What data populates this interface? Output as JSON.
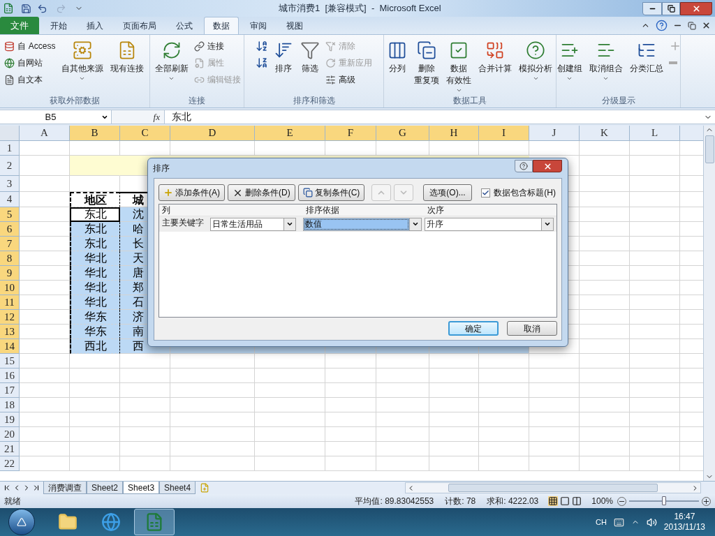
{
  "window": {
    "title": "城市消费1  [兼容模式]  -  Microsoft Excel"
  },
  "ribbon_tabs": [
    {
      "label": "文件",
      "kind": "file",
      "selected": false
    },
    {
      "label": "开始",
      "kind": "tab",
      "selected": false
    },
    {
      "label": "插入",
      "kind": "tab",
      "selected": false
    },
    {
      "label": "页面布局",
      "kind": "tab",
      "selected": false
    },
    {
      "label": "公式",
      "kind": "tab",
      "selected": false
    },
    {
      "label": "数据",
      "kind": "tab",
      "selected": true
    },
    {
      "label": "审阅",
      "kind": "tab",
      "selected": false
    },
    {
      "label": "视图",
      "kind": "tab",
      "selected": false
    }
  ],
  "ribbon_groups": [
    {
      "label": "获取外部数据",
      "items": [
        {
          "kind": "small",
          "label": "自 Access",
          "disabled": false,
          "dropdown": false
        },
        {
          "kind": "small",
          "label": "自网站",
          "disabled": false,
          "dropdown": false
        },
        {
          "kind": "small",
          "label": "自文本",
          "disabled": false,
          "dropdown": false
        },
        {
          "kind": "large",
          "label": "自其他来源",
          "disabled": false,
          "dropdown": true
        },
        {
          "kind": "large",
          "label": "现有连接",
          "disabled": false,
          "dropdown": false
        }
      ]
    },
    {
      "label": "连接",
      "items": [
        {
          "kind": "large",
          "label": "全部刷新",
          "disabled": false,
          "dropdown": true
        },
        {
          "kind": "small",
          "label": "连接",
          "disabled": false,
          "dropdown": false
        },
        {
          "kind": "small",
          "label": "属性",
          "disabled": true,
          "dropdown": false
        },
        {
          "kind": "small",
          "label": "编辑链接",
          "disabled": true,
          "dropdown": false
        }
      ]
    },
    {
      "label": "排序和筛选",
      "items": [
        {
          "kind": "icon",
          "disabled": false,
          "dropdown": false
        },
        {
          "kind": "icon",
          "disabled": false,
          "dropdown": false
        },
        {
          "kind": "large",
          "label": "排序",
          "disabled": false,
          "dropdown": false
        },
        {
          "kind": "large",
          "label": "筛选",
          "disabled": false,
          "dropdown": false
        },
        {
          "kind": "small",
          "label": "清除",
          "disabled": true,
          "dropdown": false
        },
        {
          "kind": "small",
          "label": "重新应用",
          "disabled": true,
          "dropdown": false
        },
        {
          "kind": "small",
          "label": "高级",
          "disabled": false,
          "dropdown": false
        }
      ]
    },
    {
      "label": "数据工具",
      "items": [
        {
          "kind": "large",
          "label": "分列",
          "disabled": false,
          "dropdown": false
        },
        {
          "kind": "large",
          "lines": [
            "删除",
            "重复项"
          ],
          "disabled": false,
          "dropdown": false
        },
        {
          "kind": "large",
          "lines": [
            "数据",
            "有效性"
          ],
          "disabled": false,
          "dropdown": true
        },
        {
          "kind": "large",
          "label": "合并计算",
          "disabled": false,
          "dropdown": false
        },
        {
          "kind": "large",
          "label": "模拟分析",
          "disabled": false,
          "dropdown": true
        }
      ]
    },
    {
      "label": "分级显示",
      "items": [
        {
          "kind": "large",
          "label": "创建组",
          "disabled": false,
          "dropdown": true
        },
        {
          "kind": "large",
          "label": "取消组合",
          "disabled": false,
          "dropdown": true
        },
        {
          "kind": "large",
          "label": "分类汇总",
          "disabled": false,
          "dropdown": false
        },
        {
          "kind": "icon",
          "disabled": true,
          "dropdown": false
        },
        {
          "kind": "icon",
          "disabled": true,
          "dropdown": false
        }
      ]
    }
  ],
  "formula_bar": {
    "name_box": "B5",
    "function_label": "fx",
    "value": "东北"
  },
  "columns": [
    {
      "label": "A",
      "selected": false
    },
    {
      "label": "B",
      "selected": true
    },
    {
      "label": "C",
      "selected": true
    },
    {
      "label": "D",
      "selected": true
    },
    {
      "label": "E",
      "selected": true
    },
    {
      "label": "F",
      "selected": true
    },
    {
      "label": "G",
      "selected": true
    },
    {
      "label": "H",
      "selected": true
    },
    {
      "label": "I",
      "selected": true
    },
    {
      "label": "J",
      "selected": false
    },
    {
      "label": "K",
      "selected": false
    },
    {
      "label": "L",
      "selected": false
    }
  ],
  "rows": [
    {
      "label": "1",
      "selected": false,
      "cells": []
    },
    {
      "label": "2",
      "selected": false,
      "cells": []
    },
    {
      "label": "3",
      "selected": false,
      "cells": []
    },
    {
      "label": "4",
      "selected": false,
      "cells": [
        {
          "text": "地区",
          "active": false
        },
        {
          "text": "城",
          "active": false
        }
      ]
    },
    {
      "label": "5",
      "selected": true,
      "cells": [
        {
          "text": "东北",
          "active": true
        },
        {
          "text": "沈",
          "active": false
        }
      ]
    },
    {
      "label": "6",
      "selected": true,
      "cells": [
        {
          "text": "东北",
          "active": false
        },
        {
          "text": "哈",
          "active": false
        }
      ]
    },
    {
      "label": "7",
      "selected": true,
      "cells": [
        {
          "text": "东北",
          "active": false
        },
        {
          "text": "长",
          "active": false
        }
      ]
    },
    {
      "label": "8",
      "selected": true,
      "cells": [
        {
          "text": "华北",
          "active": false
        },
        {
          "text": "天",
          "active": false
        }
      ]
    },
    {
      "label": "9",
      "selected": true,
      "cells": [
        {
          "text": "华北",
          "active": false
        },
        {
          "text": "唐",
          "active": false
        }
      ]
    },
    {
      "label": "10",
      "selected": true,
      "cells": [
        {
          "text": "华北",
          "active": false
        },
        {
          "text": "郑",
          "active": false
        }
      ]
    },
    {
      "label": "11",
      "selected": true,
      "cells": [
        {
          "text": "华北",
          "active": false
        },
        {
          "text": "石",
          "active": false
        }
      ]
    },
    {
      "label": "12",
      "selected": true,
      "cells": [
        {
          "text": "华东",
          "active": false
        },
        {
          "text": "济",
          "active": false
        }
      ]
    },
    {
      "label": "13",
      "selected": true,
      "cells": [
        {
          "text": "华东",
          "active": false
        },
        {
          "text": "南",
          "active": false
        }
      ]
    },
    {
      "label": "14",
      "selected": true,
      "cells": [
        {
          "text": "西北",
          "active": false
        },
        {
          "text": "西",
          "active": false
        }
      ]
    },
    {
      "label": "15",
      "selected": false,
      "cells": []
    },
    {
      "label": "16",
      "selected": false,
      "cells": []
    },
    {
      "label": "17",
      "selected": false,
      "cells": []
    },
    {
      "label": "18",
      "selected": false,
      "cells": []
    },
    {
      "label": "19",
      "selected": false,
      "cells": []
    },
    {
      "label": "20",
      "selected": false,
      "cells": []
    },
    {
      "label": "21",
      "selected": false,
      "cells": []
    },
    {
      "label": "22",
      "selected": false,
      "cells": []
    }
  ],
  "dialog": {
    "title": "排序",
    "toolbar": [
      {
        "kind": "add",
        "label": "添加条件(A)",
        "disabled": false
      },
      {
        "kind": "delete",
        "label": "删除条件(D)",
        "disabled": false
      },
      {
        "kind": "copy",
        "label": "复制条件(C)",
        "disabled": false
      },
      {
        "kind": "up",
        "disabled": true
      },
      {
        "kind": "down",
        "disabled": true
      },
      {
        "kind": "options",
        "label": "选项(O)...",
        "disabled": false
      }
    ],
    "header_checkbox": {
      "label": "数据包含标题(H)",
      "checked": true
    },
    "columns": [
      "列",
      "排序依据",
      "次序"
    ],
    "rows": [
      {
        "label": "主要关键字",
        "fields": [
          {
            "value": "日常生活用品",
            "focused": false
          },
          {
            "value": "数值",
            "focused": true
          },
          {
            "value": "升序",
            "focused": false
          }
        ]
      }
    ],
    "buttons": [
      {
        "label": "确定",
        "default": true
      },
      {
        "label": "取消",
        "default": false
      }
    ]
  },
  "sheet_tabs": [
    {
      "label": "消费调查",
      "selected": false
    },
    {
      "label": "Sheet2",
      "selected": false
    },
    {
      "label": "Sheet3",
      "selected": true
    },
    {
      "label": "Sheet4",
      "selected": false
    }
  ],
  "status_bar": {
    "mode": "就绪",
    "average": "平均值: 89.83042553",
    "count": "计数: 78",
    "sum": "求和: 4222.03",
    "zoom": "100%",
    "zoom_slider": {
      "level": 0.5
    }
  },
  "taskbar": {
    "apps": [
      {
        "kind": "folder",
        "active": false
      },
      {
        "kind": "browser",
        "active": false
      },
      {
        "kind": "spreadsheet",
        "active": true
      }
    ],
    "language": "CH",
    "time": "16:47",
    "date": "2013/11/13"
  }
}
